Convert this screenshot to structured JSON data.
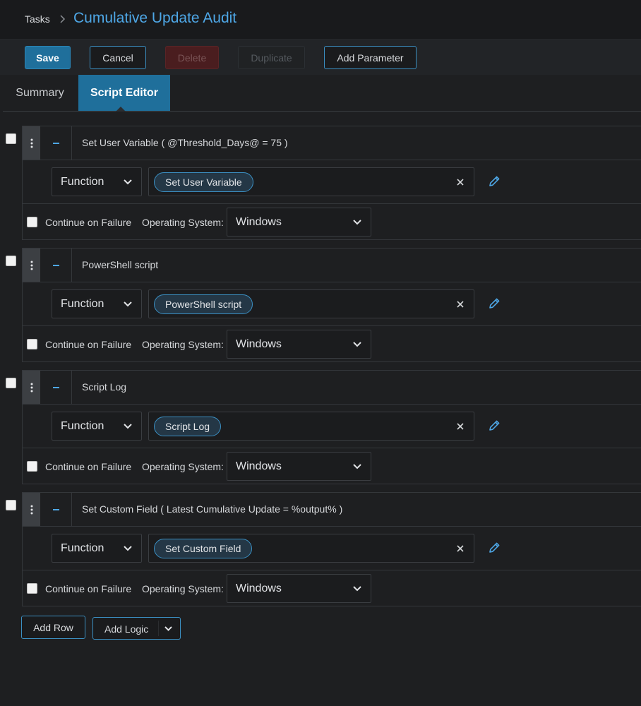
{
  "breadcrumb": {
    "root": "Tasks",
    "title": "Cumulative Update Audit"
  },
  "toolbar": {
    "save": "Save",
    "cancel": "Cancel",
    "delete": "Delete",
    "duplicate": "Duplicate",
    "add_parameter": "Add Parameter"
  },
  "tabs": {
    "summary": "Summary",
    "script_editor": "Script Editor",
    "active": "Script Editor"
  },
  "rows": [
    {
      "title": "Set User Variable ( @Threshold_Days@ = 75 )",
      "function_label": "Function",
      "function_value": "Set User Variable",
      "continue_on_failure": "Continue on Failure",
      "os_label": "Operating System:",
      "os_value": "Windows"
    },
    {
      "title": "PowerShell script",
      "function_label": "Function",
      "function_value": "PowerShell script",
      "continue_on_failure": "Continue on Failure",
      "os_label": "Operating System:",
      "os_value": "Windows"
    },
    {
      "title": "Script Log",
      "function_label": "Function",
      "function_value": "Script Log",
      "continue_on_failure": "Continue on Failure",
      "os_label": "Operating System:",
      "os_value": "Windows"
    },
    {
      "title": "Set Custom Field ( Latest Cumulative Update = %output% )",
      "function_label": "Function",
      "function_value": "Set Custom Field",
      "continue_on_failure": "Continue on Failure",
      "os_label": "Operating System:",
      "os_value": "Windows"
    }
  ],
  "footer": {
    "add_row": "Add Row",
    "add_logic": "Add Logic"
  },
  "colors": {
    "accent": "#4ea7e6",
    "primary": "#1f6f9b",
    "danger": "#4a1d1f",
    "background": "#1e1f21"
  },
  "icons": [
    "chevron-right-icon",
    "kebab-menu-icon",
    "collapse-icon",
    "chevron-down-icon",
    "clear-icon",
    "pencil-icon"
  ]
}
